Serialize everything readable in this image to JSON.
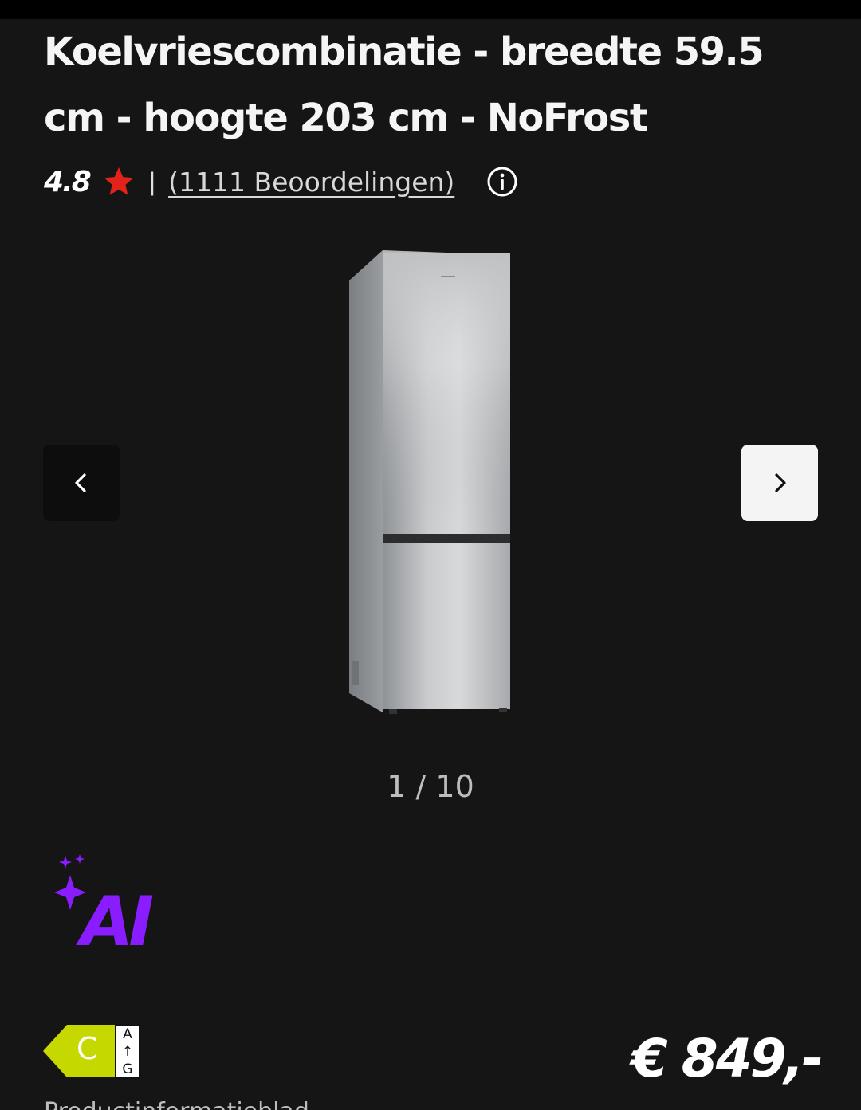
{
  "product": {
    "title": "Koelvriescombinatie - breedte 59.5 cm - hoogte 203 cm - NoFrost"
  },
  "rating": {
    "value": "4.8",
    "separator": "|",
    "reviews_label": "(1111 Beoordelingen)",
    "star_color": "#e2231a"
  },
  "icons": {
    "star": "star-icon",
    "info": "info-icon",
    "prev": "chevron-left-icon",
    "next": "chevron-right-icon",
    "ai": "ai-sparkle-icon"
  },
  "gallery": {
    "pager": "1 / 10",
    "current": 1,
    "total": 10
  },
  "badge": {
    "label": "AI",
    "color": "#8a1dff"
  },
  "energy": {
    "class": "C",
    "scale_top": "A",
    "scale_arrow": "↑",
    "scale_bottom": "G",
    "color": "#c5d900"
  },
  "price": {
    "amount": "€ 849,-"
  },
  "links": {
    "product_info": "Productinformatieblad"
  }
}
